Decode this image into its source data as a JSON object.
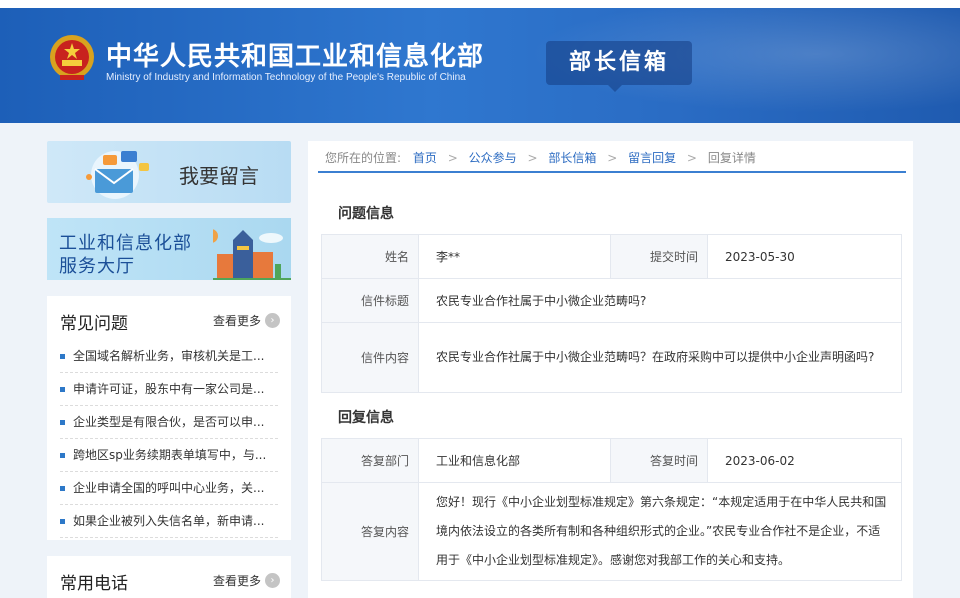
{
  "header": {
    "title": "中华人民共和国工业和信息化部",
    "subtitle": "Ministry of Industry and Information Technology of the People's Republic of China",
    "section": "部长信箱",
    "emblem_icon": "national-emblem-icon"
  },
  "sidebar": {
    "leave_message": "我要留言",
    "service_hall": {
      "line1": "工业和信息化部",
      "line2": "服务大厅"
    },
    "faq": {
      "title": "常见问题",
      "more": "查看更多",
      "items": [
        "全国域名解析业务，审核机关是工...",
        "申请许可证，股东中有一家公司是...",
        "企业类型是有限合伙，是否可以申...",
        "跨地区sp业务续期表单填写中，与...",
        "企业申请全国的呼叫中心业务，关...",
        "如果企业被列入失信名单，新申请..."
      ]
    },
    "phone": {
      "title": "常用电话",
      "more": "查看更多"
    }
  },
  "breadcrumb": {
    "prefix": "您所在的位置:",
    "items": [
      "首页",
      "公众参与",
      "部长信箱",
      "留言回复"
    ],
    "current": "回复详情"
  },
  "question": {
    "section_title": "问题信息",
    "name_label": "姓名",
    "name": "李**",
    "submit_label": "提交时间",
    "submit_time": "2023-05-30",
    "subject_label": "信件标题",
    "subject": "农民专业合作社属于中小微企业范畴吗?",
    "content_label": "信件内容",
    "content": "农民专业合作社属于中小微企业范畴吗？在政府采购中可以提供中小企业声明函吗?"
  },
  "reply": {
    "section_title": "回复信息",
    "dept_label": "答复部门",
    "dept": "工业和信息化部",
    "time_label": "答复时间",
    "time": "2023-06-02",
    "content_label": "答复内容",
    "content": "您好！现行《中小企业划型标准规定》第六条规定：“本规定适用于在中华人民共和国境内依法设立的各类所有制和各种组织形式的企业。”农民专业合作社不是企业，不适用于《中小企业划型标准规定》。感谢您对我部工作的关心和支持。"
  },
  "colors": {
    "header_blue": "#2a6cc4",
    "link_blue": "#2d6cc2",
    "accent_line": "#3b7fd1"
  }
}
